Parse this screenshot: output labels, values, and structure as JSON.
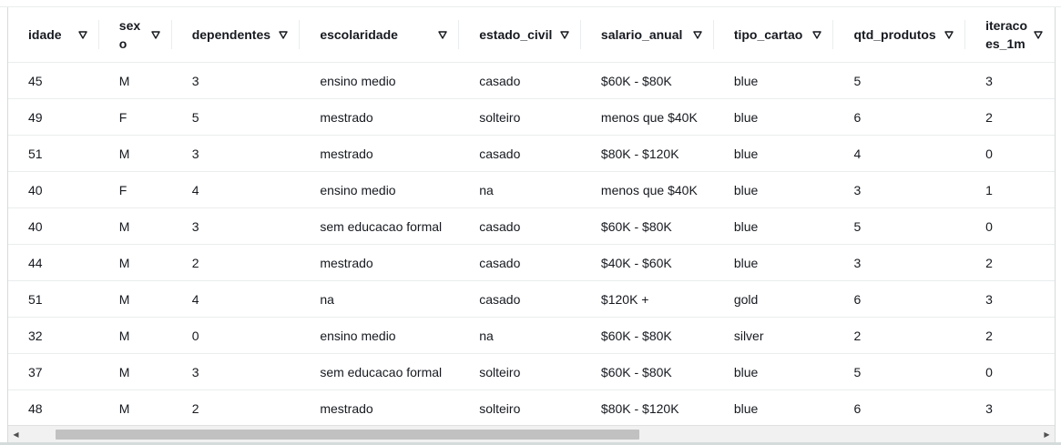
{
  "table": {
    "columns": [
      {
        "key": "idade",
        "label": "idade"
      },
      {
        "key": "sexo",
        "label": "sexo"
      },
      {
        "key": "dependentes",
        "label": "dependentes"
      },
      {
        "key": "escolaridade",
        "label": "escolaridade"
      },
      {
        "key": "estado_civil",
        "label": "estado_civil"
      },
      {
        "key": "salario_anual",
        "label": "salario_anual"
      },
      {
        "key": "tipo_cartao",
        "label": "tipo_cartao"
      },
      {
        "key": "qtd_produtos",
        "label": "qtd_produtos"
      },
      {
        "key": "iteracoes_12m",
        "label": "iteracoes_1m"
      }
    ],
    "rows": [
      [
        "45",
        "M",
        "3",
        "ensino medio",
        "casado",
        "$60K - $80K",
        "blue",
        "5",
        "3"
      ],
      [
        "49",
        "F",
        "5",
        "mestrado",
        "solteiro",
        "menos que $40K",
        "blue",
        "6",
        "2"
      ],
      [
        "51",
        "M",
        "3",
        "mestrado",
        "casado",
        "$80K - $120K",
        "blue",
        "4",
        "0"
      ],
      [
        "40",
        "F",
        "4",
        "ensino medio",
        "na",
        "menos que $40K",
        "blue",
        "3",
        "1"
      ],
      [
        "40",
        "M",
        "3",
        "sem educacao formal",
        "casado",
        "$60K - $80K",
        "blue",
        "5",
        "0"
      ],
      [
        "44",
        "M",
        "2",
        "mestrado",
        "casado",
        "$40K - $60K",
        "blue",
        "3",
        "2"
      ],
      [
        "51",
        "M",
        "4",
        "na",
        "casado",
        "$120K +",
        "gold",
        "6",
        "3"
      ],
      [
        "32",
        "M",
        "0",
        "ensino medio",
        "na",
        "$60K - $80K",
        "silver",
        "2",
        "2"
      ],
      [
        "37",
        "M",
        "3",
        "sem educacao formal",
        "solteiro",
        "$60K - $80K",
        "blue",
        "5",
        "0"
      ],
      [
        "48",
        "M",
        "2",
        "mestrado",
        "solteiro",
        "$80K - $120K",
        "blue",
        "6",
        "3"
      ]
    ]
  },
  "icons": {
    "sort": "sort-down-triangle-icon",
    "scroll_left": "scroll-left-arrow-icon",
    "scroll_right": "scroll-right-arrow-icon"
  }
}
